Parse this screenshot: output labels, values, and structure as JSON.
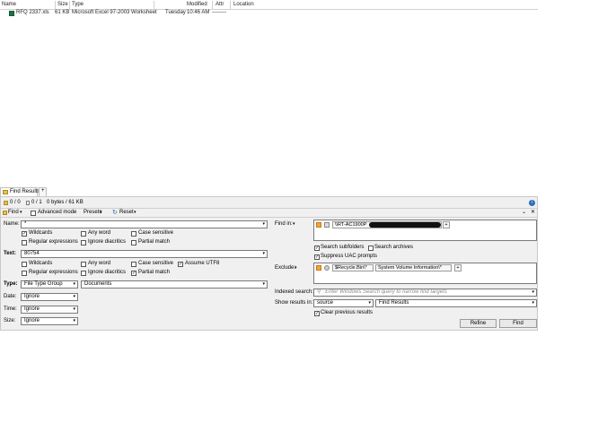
{
  "columns": {
    "name": "Name",
    "size": "Size",
    "type": "Type",
    "modified": "Modified",
    "attr": "Attr",
    "location": "Location"
  },
  "file": {
    "name": "RFQ 2337.xls",
    "size": "61 KB",
    "type": "Microsoft Excel 97-2003 Worksheet",
    "day": "Tuesday",
    "time": "10:46 AM",
    "attr": "--------"
  },
  "tab": {
    "title": "Find Results",
    "add": "+"
  },
  "status": {
    "count1": "0 / 0",
    "count2": "0 / 1",
    "bytes": "0 bytes / 61 KB"
  },
  "toolbar": {
    "find": "Find",
    "advanced": "Advanced mode",
    "presets": "Presets",
    "reset": "Reset"
  },
  "form": {
    "name_label": "Name:",
    "name_value": "*",
    "wildcards": "Wildcards",
    "any_word": "Any word",
    "case_sensitive": "Case sensitive",
    "regex": "Regular expressions",
    "ignore_diacritics": "Ignore diacritics",
    "partial_match": "Partial match",
    "text_label": "Text:",
    "text_value": "80754",
    "assume_utf8": "Assume UTF8",
    "type_label": "Type:",
    "type_value": "File Type Group",
    "type_value2": "Documents",
    "date_label": "Date:",
    "date_value": "Ignore",
    "time_label": "Time:",
    "time_value": "Ignore",
    "size_label": "Size:",
    "size_value": "Ignore"
  },
  "right": {
    "find_in_label": "Find in:",
    "path": "\\\\RT-AC1900P",
    "search_subfolders": "Search subfolders",
    "search_archives": "Search archives",
    "suppress_uac": "Suppress UAC prompts",
    "exclude_label": "Exclude:",
    "exclude1": "$Recycle.Bin\\*",
    "exclude2": "System Volume Information\\*",
    "indexed_label": "Indexed search:",
    "indexed_placeholder": "Enter Windows Search query to narrow find targets",
    "show_label": "Show results in:",
    "show_value1": "source",
    "show_value2": "Find Results",
    "clear_prev": "Clear previous results",
    "refine": "Refine",
    "find": "Find"
  },
  "colors": {
    "accent": "#2a6ebb",
    "panel": "#f0f0f0",
    "redacted": "#111111"
  }
}
